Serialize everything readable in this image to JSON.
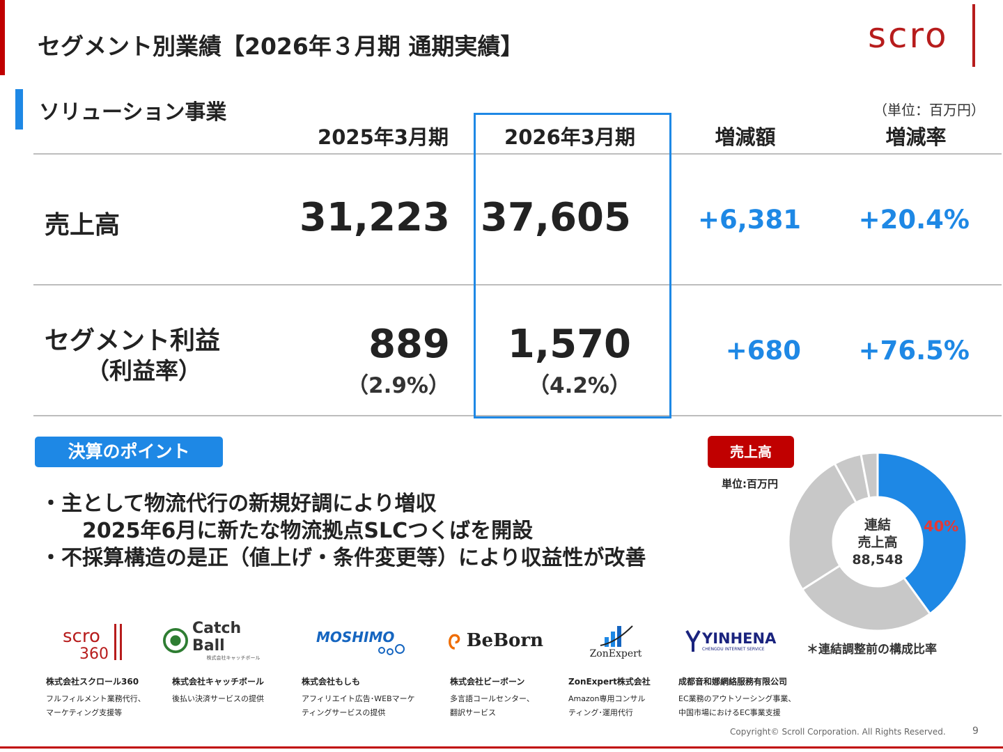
{
  "header": {
    "title": "セグメント別業績【2026年３月期 通期実績】",
    "logo_text": "scro"
  },
  "section": {
    "title": "ソリューション事業",
    "unit": "（単位：百万円）"
  },
  "table": {
    "columns": [
      "2025年3月期",
      "2026年3月期",
      "増減額",
      "増減率"
    ],
    "rows": [
      {
        "label": "売上高",
        "sublabel": "",
        "prev": "31,223",
        "prev_sub": "",
        "curr": "37,605",
        "curr_sub": "",
        "diff": "+6,381",
        "rate": "+20.4%"
      },
      {
        "label": "セグメント利益",
        "sublabel": "（利益率）",
        "prev": "889",
        "prev_sub": "（2.9%）",
        "curr": "1,570",
        "curr_sub": "（4.2%）",
        "diff": "+680",
        "rate": "+76.5%"
      }
    ]
  },
  "points": {
    "tag": "決算のポイント",
    "lines": [
      "・主として物流代行の新規好調により増収",
      "2025年6月に新たな物流拠点SLCつくばを開設",
      "・不採算構造の是正（値上げ・条件変更等）により収益性が改善"
    ]
  },
  "donut": {
    "tag": "売上高",
    "unit": "単位:百万円",
    "center_lines": [
      "連結",
      "売上高",
      "88,548"
    ],
    "highlight_pct": "40%",
    "footnote": "＊連結調整前の構成比率",
    "colors": {
      "highlight": "#1e88e5",
      "other": "#c8c8c8"
    }
  },
  "chart_data": {
    "type": "pie",
    "title": "売上高",
    "total": 88548,
    "slices": [
      {
        "name": "ソリューション事業",
        "value": 40,
        "color": "#1e88e5"
      },
      {
        "value": 26,
        "color": "#c8c8c8"
      },
      {
        "value": 26,
        "color": "#c8c8c8"
      },
      {
        "value": 5,
        "color": "#c8c8c8"
      },
      {
        "value": 3,
        "color": "#c8c8c8"
      }
    ]
  },
  "companies": [
    {
      "logo": "scro 360",
      "name": "株式会社スクロール360",
      "desc": [
        "フルフィルメント業務代行、",
        "マーケティング支援等"
      ]
    },
    {
      "logo": "Catch Ball",
      "logo_sub": "株式会社キャッチボール",
      "name": "株式会社キャッチボール",
      "desc": [
        "後払い決済サービスの提供"
      ]
    },
    {
      "logo": "MOSHIMO",
      "name": "株式会社もしも",
      "desc": [
        "アフィリエイト広告･WEBマーケ",
        "ティングサービスの提供"
      ]
    },
    {
      "logo": "BeBorn",
      "name": "株式会社ビーボーン",
      "desc": [
        "多言語コールセンター、",
        "翻訳サービス"
      ]
    },
    {
      "logo": "ZonExpert",
      "name": "ZonExpert株式会社",
      "desc": [
        "Amazon専用コンサル",
        "ティング･運用代行"
      ]
    },
    {
      "logo": "YINHENA",
      "logo_sub": "CHENGDU INTERNET SERVICE",
      "name": "成都音和娜網絡服務有限公司",
      "desc": [
        "EC業務のアウトソーシング事業、",
        "中国市場におけるEC事業支援"
      ]
    }
  ],
  "footer": {
    "copyright": "Copyright© Scroll Corporation. All Rights Reserved.",
    "page": "9"
  }
}
